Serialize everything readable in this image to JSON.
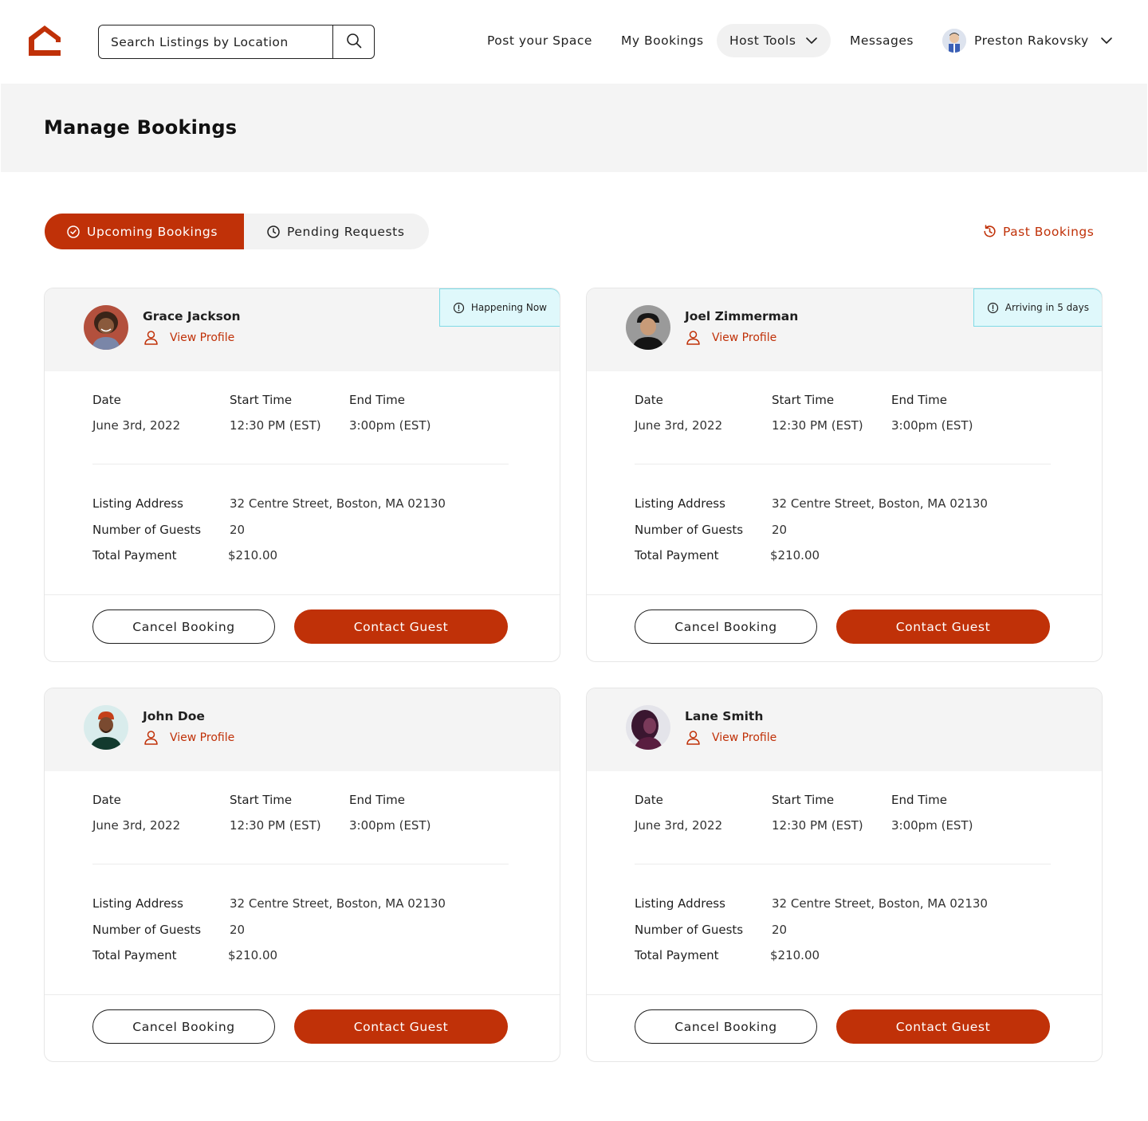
{
  "header": {
    "search_placeholder": "Search Listings by Location",
    "nav": {
      "post_space": "Post your Space",
      "my_bookings": "My Bookings",
      "host_tools": "Host Tools",
      "messages": "Messages",
      "user_name": "Preston Rakovsky"
    }
  },
  "page": {
    "title": "Manage Bookings"
  },
  "tabs": {
    "upcoming": "Upcoming Bookings",
    "pending": "Pending Requests",
    "past": "Past Bookings"
  },
  "labels": {
    "date": "Date",
    "start_time": "Start Time",
    "end_time": "End Time",
    "listing_address": "Listing Address",
    "number_of_guests": "Number of Guests",
    "total_payment": "Total Payment",
    "view_profile": "View Profile",
    "cancel_booking": "Cancel Booking",
    "contact_guest": "Contact Guest"
  },
  "colors": {
    "accent": "#c03108",
    "badge_bg": "#dff8fb",
    "badge_border": "#7fdbe6",
    "panel_bg": "#f4f4f4"
  },
  "bookings": [
    {
      "guest": "Grace Jackson",
      "status": "Happening Now",
      "date": "June 3rd, 2022",
      "start": "12:30 PM (EST)",
      "end": "3:00pm (EST)",
      "address": "32 Centre Street, Boston, MA 02130",
      "guests": "20",
      "payment": "$210.00"
    },
    {
      "guest": "Joel Zimmerman",
      "status": "Arriving in 5 days",
      "date": "June 3rd, 2022",
      "start": "12:30 PM (EST)",
      "end": "3:00pm (EST)",
      "address": "32 Centre Street, Boston, MA 02130",
      "guests": "20",
      "payment": "$210.00"
    },
    {
      "guest": "John Doe",
      "date": "June 3rd, 2022",
      "start": "12:30 PM (EST)",
      "end": "3:00pm (EST)",
      "address": "32 Centre Street, Boston, MA 02130",
      "guests": "20",
      "payment": "$210.00"
    },
    {
      "guest": "Lane Smith",
      "date": "June 3rd, 2022",
      "start": "12:30 PM (EST)",
      "end": "3:00pm (EST)",
      "address": "32 Centre Street, Boston, MA 02130",
      "guests": "20",
      "payment": "$210.00"
    }
  ]
}
